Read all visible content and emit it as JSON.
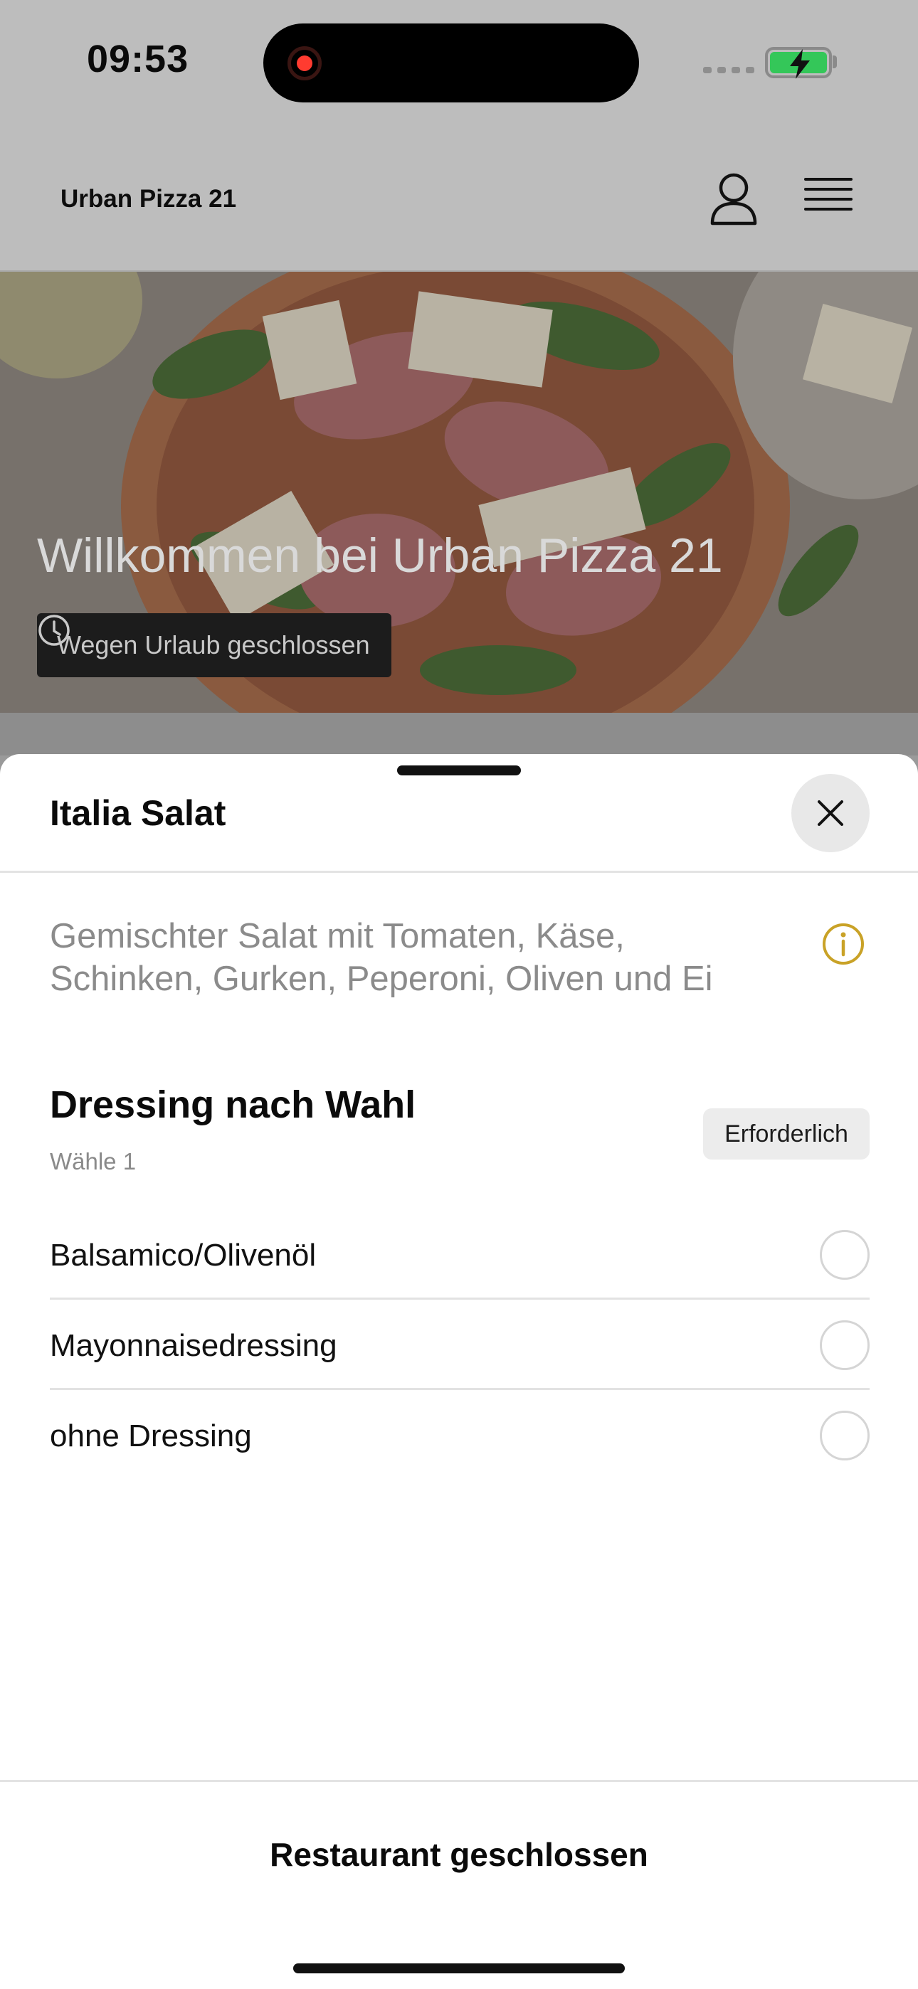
{
  "status_bar": {
    "time": "09:53",
    "recording_icon": "screen-recording-icon",
    "battery_icon": "battery-charging-icon",
    "battery_color": "#34c759",
    "record_color": "#ff3b30"
  },
  "header": {
    "brand": "Urban Pizza 21",
    "user_icon": "user-icon",
    "menu_icon": "hamburger-menu-icon"
  },
  "hero": {
    "title": "Willkommen bei Urban Pizza 21",
    "status_badge": "Wegen Urlaub geschlossen",
    "status_icon": "clock-icon"
  },
  "sheet": {
    "title": "Italia Salat",
    "close_icon": "close-icon",
    "description": "Gemischter Salat mit Tomaten, Käse, Schinken, Gurken, Peperoni, Oliven und Ei",
    "info_icon": "info-icon",
    "info_color": "#c9a227",
    "group": {
      "title": "Dressing nach Wahl",
      "subtitle": "Wähle 1",
      "required_badge": "Erforderlich",
      "options": [
        {
          "label": "Balsamico/Olivenöl",
          "selected": false
        },
        {
          "label": "Mayonnaisedressing",
          "selected": false
        },
        {
          "label": "ohne Dressing",
          "selected": false
        }
      ]
    },
    "footer_button": "Restaurant geschlossen"
  }
}
